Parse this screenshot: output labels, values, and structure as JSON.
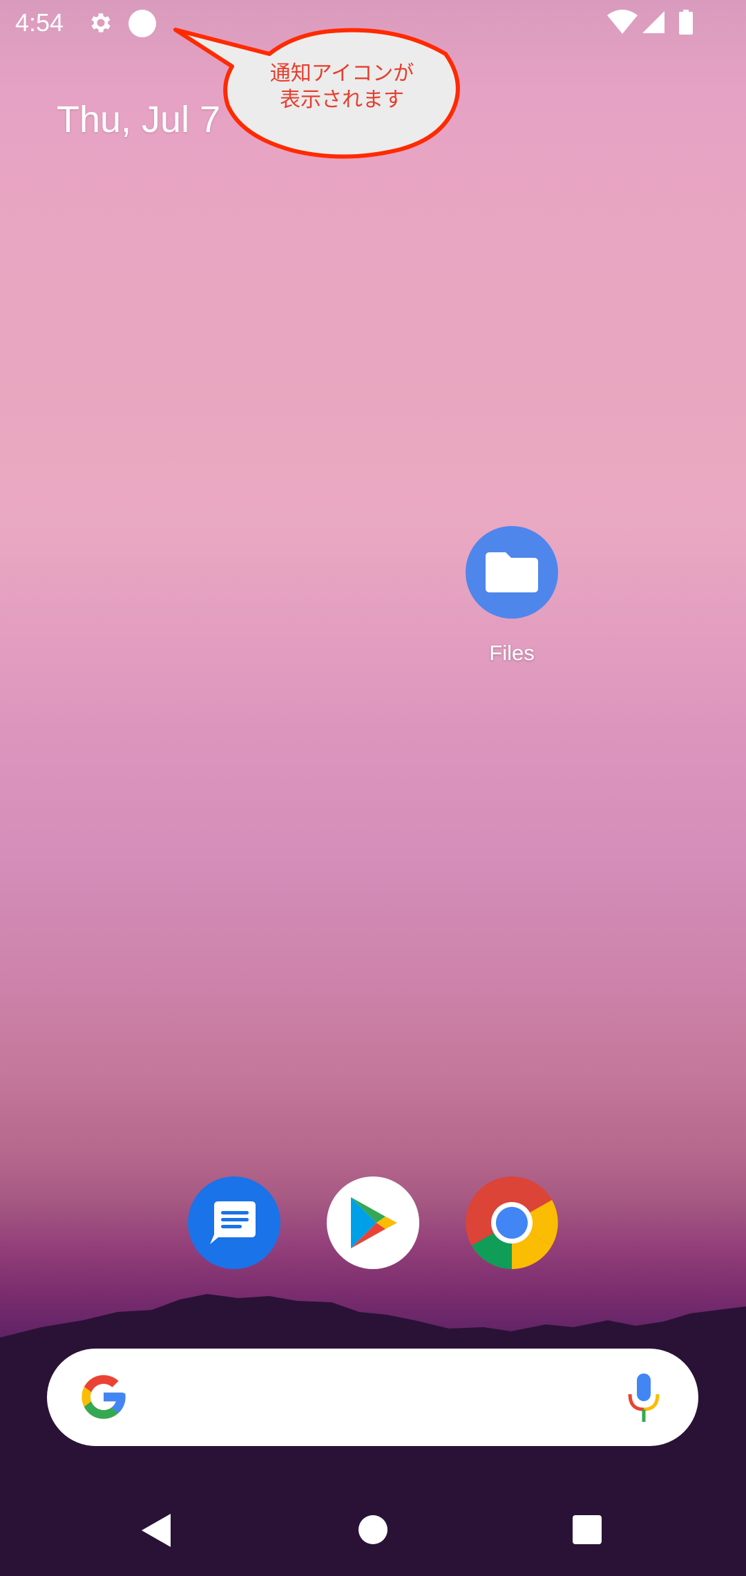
{
  "status_bar": {
    "time": "4:54",
    "icons": [
      "settings-gear-icon",
      "notification-dot-icon",
      "wifi-icon",
      "cell-signal-icon",
      "battery-icon"
    ]
  },
  "home": {
    "date": "Thu, Jul 7",
    "apps": [
      {
        "name": "Files",
        "icon": "files-folder-icon",
        "color": "#4f86ec"
      }
    ],
    "dock": [
      {
        "icon": "messages-icon",
        "color": "#1a73e8"
      },
      {
        "icon": "play-store-icon",
        "color": "#ffffff"
      },
      {
        "icon": "chrome-icon",
        "color": "#db4437"
      }
    ]
  },
  "annotation": {
    "text": "通知アイコンが\n表示されます",
    "line1": "通知アイコンが",
    "line2": "表示されます",
    "color": "#e53e2e"
  },
  "search_bar": {
    "left_icon": "google-g-icon",
    "right_icon": "microphone-icon"
  },
  "nav_bar": {
    "buttons": [
      "back-icon",
      "home-icon",
      "recents-icon"
    ]
  }
}
